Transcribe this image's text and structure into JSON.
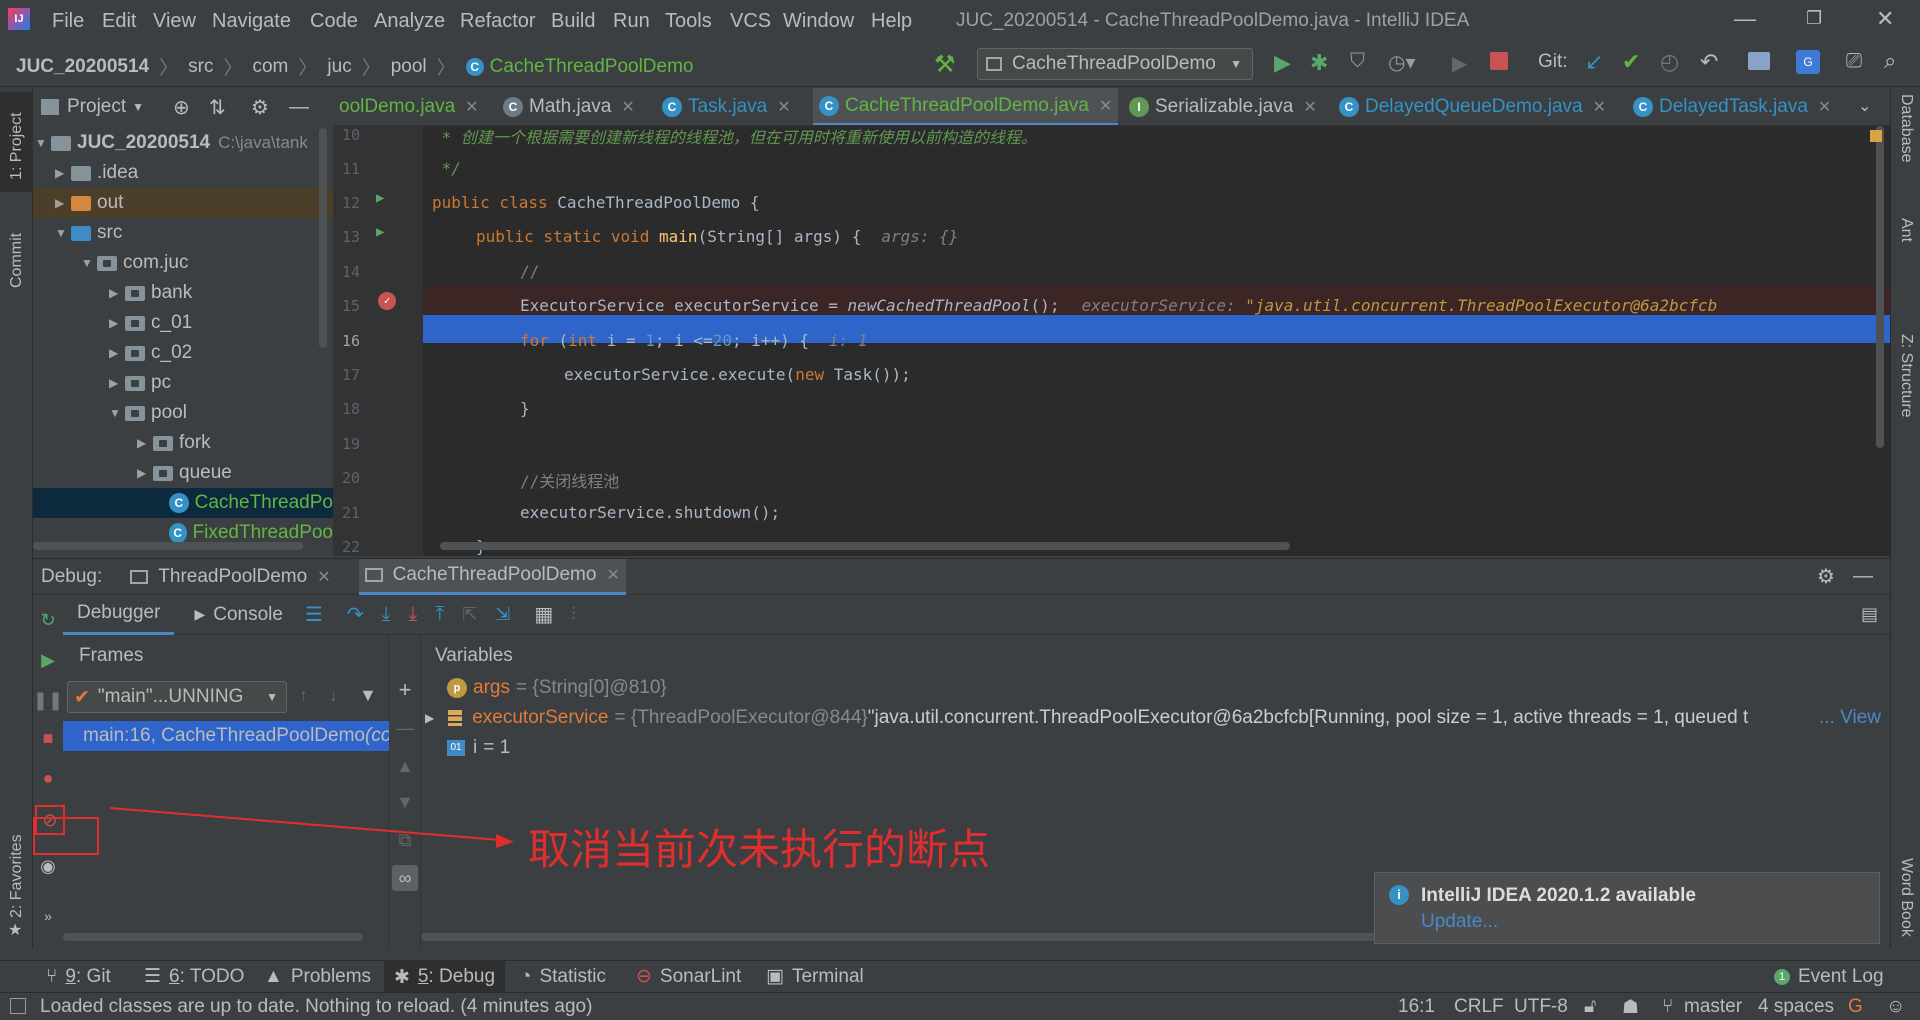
{
  "window": {
    "title": "JUC_20200514 - CacheThreadPoolDemo.java - IntelliJ IDEA",
    "app_icon": "intellij-icon"
  },
  "menu": [
    "File",
    "Edit",
    "View",
    "Navigate",
    "Code",
    "Analyze",
    "Refactor",
    "Build",
    "Run",
    "Tools",
    "VCS",
    "Window",
    "Help"
  ],
  "breadcrumb": [
    "JUC_20200514",
    "src",
    "com",
    "juc",
    "pool",
    "CacheThreadPoolDemo"
  ],
  "run_config": "CacheThreadPoolDemo",
  "git_label": "Git:",
  "project_panel": {
    "title": "Project",
    "tree": [
      {
        "label": "JUC_20200514",
        "path": "C:\\java\\tank"
      },
      {
        "label": ".idea"
      },
      {
        "label": "out"
      },
      {
        "label": "src"
      },
      {
        "label": "com.juc"
      },
      {
        "label": "bank"
      },
      {
        "label": "c_01"
      },
      {
        "label": "c_02"
      },
      {
        "label": "pc"
      },
      {
        "label": "pool"
      },
      {
        "label": "fork"
      },
      {
        "label": "queue"
      },
      {
        "label": "CacheThreadPo"
      },
      {
        "label": "FixedThreadPoo"
      }
    ]
  },
  "tabs": [
    "oolDemo.java",
    "Math.java",
    "Task.java",
    "CacheThreadPoolDemo.java",
    "Serializable.java",
    "DelayedQueueDemo.java",
    "DelayedTask.java"
  ],
  "code": {
    "line_numbers": [
      "10",
      "11",
      "12",
      "13",
      "14",
      "15",
      "16",
      "17",
      "18",
      "19",
      "20",
      "21",
      "22"
    ],
    "l10": " * 创建一个根据需要创建新线程的线程池，但在可用时将重新使用以前构造的线程。",
    "l11": " */",
    "l12_kw": "public class ",
    "l12_name": "CacheThreadPoolDemo {",
    "l13_kw": "public static void ",
    "l13_fn": "main",
    "l13_rest": "(String[] args) {",
    "l13_hint": "args: {}",
    "l14": "//",
    "l15_a": "ExecutorService executorService = ",
    "l15_fn": "newCachedThreadPool",
    "l15_b": "();",
    "l15_hint": "executorService: ",
    "l15_hintval": "\"java.util.concurrent.ThreadPoolExecutor@6a2bcfcb",
    "l16_kw": "for",
    "l16_a": " (",
    "l16_int": "int",
    "l16_b": " i = ",
    "l16_n1": "1",
    "l16_c": "; i <=",
    "l16_n2": "20",
    "l16_d": "; i++) {",
    "l16_hint": "i: 1",
    "l17_a": "executorService.execute(",
    "l17_kw": "new",
    "l17_b": " Task());",
    "l18": "}",
    "l20": "//关闭线程池",
    "l21": "executorService.shutdown();",
    "l22": "}"
  },
  "debug": {
    "label": "Debug:",
    "tabs": [
      "ThreadPoolDemo",
      "CacheThreadPoolDemo"
    ],
    "subtabs": [
      "Debugger",
      "Console"
    ],
    "frames_title": "Frames",
    "variables_title": "Variables",
    "thread": "\"main\"...UNNING",
    "frame": "main:16, CacheThreadPoolDemo ",
    "frame_pkg": "(com.",
    "vars": [
      {
        "name": "args",
        "value": "= {String[0]@810}"
      },
      {
        "name": "executorService",
        "value": "= {ThreadPoolExecutor@844} ",
        "detail": "\"java.util.concurrent.ThreadPoolExecutor@6a2bcfcb[Running, pool size = 1, active threads = 1, queued t",
        "more": "... View"
      },
      {
        "name": "i",
        "value": "= 1"
      }
    ],
    "annotation": "取消当前次未执行的断点"
  },
  "notification": {
    "title": "IntelliJ IDEA 2020.1.2 available",
    "link": "Update..."
  },
  "side_left": [
    "1: Project",
    "Commit",
    "2: Favorites"
  ],
  "side_right": [
    "Database",
    "Ant",
    "Z: Structure",
    "Word Book"
  ],
  "bottom_tools": [
    {
      "num": "9",
      "label": ": Git"
    },
    {
      "num": "6",
      "label": ": TODO"
    },
    {
      "num": "",
      "label": "Problems"
    },
    {
      "num": "5",
      "label": ": Debug"
    },
    {
      "num": "",
      "label": "Statistic"
    },
    {
      "num": "",
      "label": "SonarLint"
    },
    {
      "num": "",
      "label": "Terminal"
    }
  ],
  "event_log": "Event Log",
  "status": {
    "message": "Loaded classes are up to date. Nothing to reload. (4 minutes ago)",
    "pos": "16:1",
    "eol": "CRLF",
    "enc": "UTF-8",
    "branch": "master",
    "indent": "4 spaces"
  },
  "colors": {
    "accent": "#4a88c7",
    "selection": "#2f65ca",
    "annotation": "#e02e2e"
  }
}
